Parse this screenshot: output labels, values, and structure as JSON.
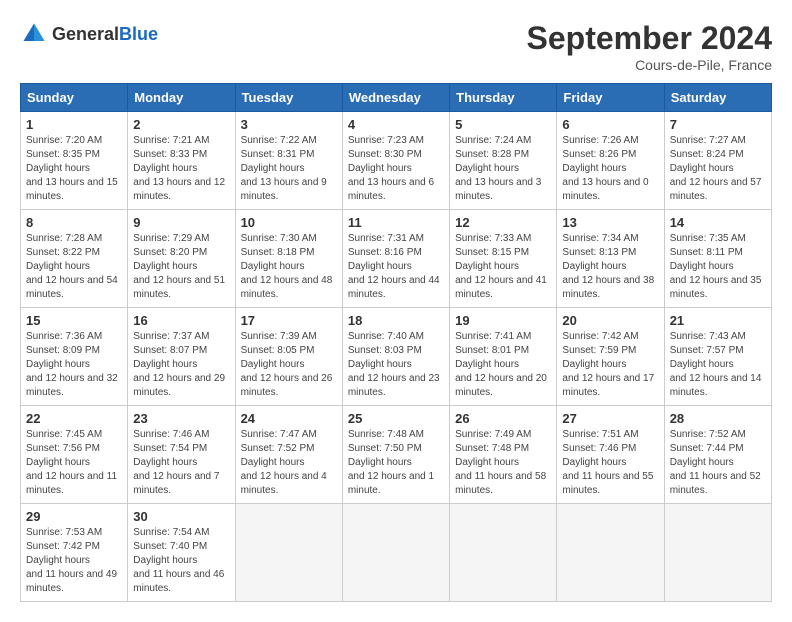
{
  "header": {
    "logo_general": "General",
    "logo_blue": "Blue",
    "month_title": "September 2024",
    "location": "Cours-de-Pile, France"
  },
  "weekdays": [
    "Sunday",
    "Monday",
    "Tuesday",
    "Wednesday",
    "Thursday",
    "Friday",
    "Saturday"
  ],
  "weeks": [
    [
      {
        "day": "1",
        "sunrise": "7:20 AM",
        "sunset": "8:35 PM",
        "daylight": "13 hours and 15 minutes."
      },
      {
        "day": "2",
        "sunrise": "7:21 AM",
        "sunset": "8:33 PM",
        "daylight": "13 hours and 12 minutes."
      },
      {
        "day": "3",
        "sunrise": "7:22 AM",
        "sunset": "8:31 PM",
        "daylight": "13 hours and 9 minutes."
      },
      {
        "day": "4",
        "sunrise": "7:23 AM",
        "sunset": "8:30 PM",
        "daylight": "13 hours and 6 minutes."
      },
      {
        "day": "5",
        "sunrise": "7:24 AM",
        "sunset": "8:28 PM",
        "daylight": "13 hours and 3 minutes."
      },
      {
        "day": "6",
        "sunrise": "7:26 AM",
        "sunset": "8:26 PM",
        "daylight": "13 hours and 0 minutes."
      },
      {
        "day": "7",
        "sunrise": "7:27 AM",
        "sunset": "8:24 PM",
        "daylight": "12 hours and 57 minutes."
      }
    ],
    [
      {
        "day": "8",
        "sunrise": "7:28 AM",
        "sunset": "8:22 PM",
        "daylight": "12 hours and 54 minutes."
      },
      {
        "day": "9",
        "sunrise": "7:29 AM",
        "sunset": "8:20 PM",
        "daylight": "12 hours and 51 minutes."
      },
      {
        "day": "10",
        "sunrise": "7:30 AM",
        "sunset": "8:18 PM",
        "daylight": "12 hours and 48 minutes."
      },
      {
        "day": "11",
        "sunrise": "7:31 AM",
        "sunset": "8:16 PM",
        "daylight": "12 hours and 44 minutes."
      },
      {
        "day": "12",
        "sunrise": "7:33 AM",
        "sunset": "8:15 PM",
        "daylight": "12 hours and 41 minutes."
      },
      {
        "day": "13",
        "sunrise": "7:34 AM",
        "sunset": "8:13 PM",
        "daylight": "12 hours and 38 minutes."
      },
      {
        "day": "14",
        "sunrise": "7:35 AM",
        "sunset": "8:11 PM",
        "daylight": "12 hours and 35 minutes."
      }
    ],
    [
      {
        "day": "15",
        "sunrise": "7:36 AM",
        "sunset": "8:09 PM",
        "daylight": "12 hours and 32 minutes."
      },
      {
        "day": "16",
        "sunrise": "7:37 AM",
        "sunset": "8:07 PM",
        "daylight": "12 hours and 29 minutes."
      },
      {
        "day": "17",
        "sunrise": "7:39 AM",
        "sunset": "8:05 PM",
        "daylight": "12 hours and 26 minutes."
      },
      {
        "day": "18",
        "sunrise": "7:40 AM",
        "sunset": "8:03 PM",
        "daylight": "12 hours and 23 minutes."
      },
      {
        "day": "19",
        "sunrise": "7:41 AM",
        "sunset": "8:01 PM",
        "daylight": "12 hours and 20 minutes."
      },
      {
        "day": "20",
        "sunrise": "7:42 AM",
        "sunset": "7:59 PM",
        "daylight": "12 hours and 17 minutes."
      },
      {
        "day": "21",
        "sunrise": "7:43 AM",
        "sunset": "7:57 PM",
        "daylight": "12 hours and 14 minutes."
      }
    ],
    [
      {
        "day": "22",
        "sunrise": "7:45 AM",
        "sunset": "7:56 PM",
        "daylight": "12 hours and 11 minutes."
      },
      {
        "day": "23",
        "sunrise": "7:46 AM",
        "sunset": "7:54 PM",
        "daylight": "12 hours and 7 minutes."
      },
      {
        "day": "24",
        "sunrise": "7:47 AM",
        "sunset": "7:52 PM",
        "daylight": "12 hours and 4 minutes."
      },
      {
        "day": "25",
        "sunrise": "7:48 AM",
        "sunset": "7:50 PM",
        "daylight": "12 hours and 1 minute."
      },
      {
        "day": "26",
        "sunrise": "7:49 AM",
        "sunset": "7:48 PM",
        "daylight": "11 hours and 58 minutes."
      },
      {
        "day": "27",
        "sunrise": "7:51 AM",
        "sunset": "7:46 PM",
        "daylight": "11 hours and 55 minutes."
      },
      {
        "day": "28",
        "sunrise": "7:52 AM",
        "sunset": "7:44 PM",
        "daylight": "11 hours and 52 minutes."
      }
    ],
    [
      {
        "day": "29",
        "sunrise": "7:53 AM",
        "sunset": "7:42 PM",
        "daylight": "11 hours and 49 minutes."
      },
      {
        "day": "30",
        "sunrise": "7:54 AM",
        "sunset": "7:40 PM",
        "daylight": "11 hours and 46 minutes."
      },
      null,
      null,
      null,
      null,
      null
    ]
  ]
}
